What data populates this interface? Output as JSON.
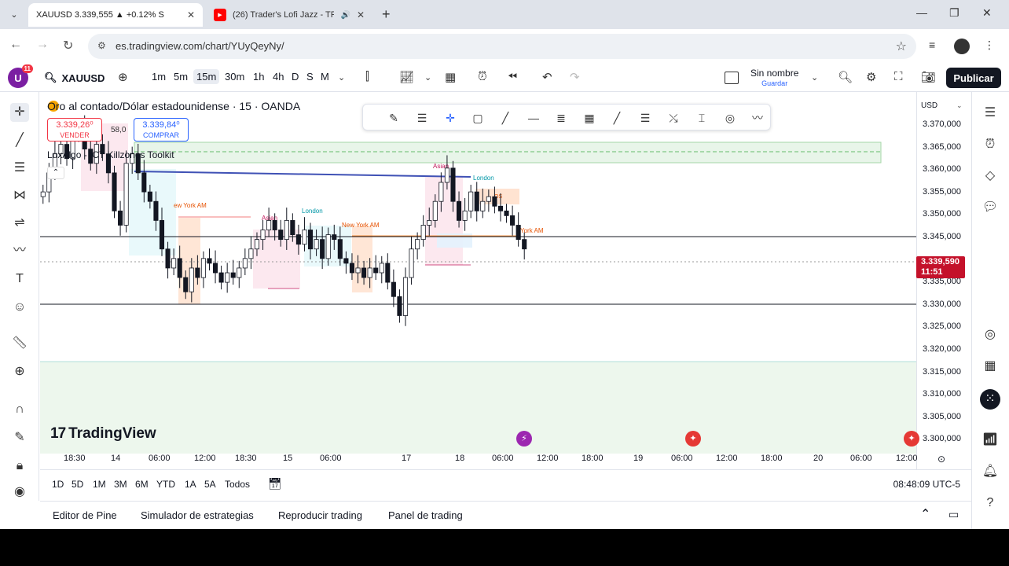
{
  "browser": {
    "tabs": [
      {
        "title": "XAUUSD 3.339,555 ▲ +0.12% S",
        "active": true,
        "favicon": "tradingview-icon"
      },
      {
        "title": "(26) Trader's Lofi Jazz - TRA",
        "active": false,
        "favicon": "youtube-icon"
      }
    ],
    "new_tab": "+",
    "url": "es.tradingview.com/chart/YUyQeyNy/"
  },
  "header": {
    "avatar_letter": "U",
    "notifications": "11",
    "symbol": "XAUUSD",
    "timeframes": [
      "1m",
      "5m",
      "15m",
      "30m",
      "1h",
      "4h",
      "D",
      "S",
      "M"
    ],
    "active_timeframe": "15m",
    "layout_name": "Sin nombre",
    "layout_status": "Guardar",
    "publish_label": "Publicar"
  },
  "legend": {
    "title": "Oro al contado/Dólar estadounidense · 15 · OANDA",
    "sell_price": "3.339,26⁰",
    "sell_label": "VENDER",
    "spread": "58,0",
    "buy_price": "3.339,84⁰",
    "buy_label": "COMPRAR",
    "indicator": "LuxAlgo - ICT Killzones Toolkit",
    "collapse": "⌃"
  },
  "price_axis": {
    "currency": "USD",
    "labels": [
      "3.370,000",
      "3.365,000",
      "3.360,000",
      "3.355,000",
      "3.350,000",
      "3.345,000",
      "3.335,000",
      "3.330,000",
      "3.325,000",
      "3.320,000",
      "3.315,000",
      "3.310,000",
      "3.305,000",
      "3.300,000"
    ],
    "current_price": "3.339,590",
    "countdown": "11:51"
  },
  "time_axis": {
    "labels": [
      "18:30",
      "14",
      "06:00",
      "12:00",
      "18:30",
      "15",
      "06:00",
      "17",
      "18",
      "06:00",
      "12:00",
      "18:00",
      "19",
      "06:00",
      "12:00",
      "18:00",
      "20",
      "06:00",
      "12:00"
    ]
  },
  "session_labels": {
    "asian1": "Asian",
    "london1": "London",
    "nyam1": "New York AM",
    "ny0": "ew York AM",
    "asian2": "Asian",
    "london2": "London",
    "nyam2": "York AM",
    "os": "OS"
  },
  "range_bar": {
    "ranges": [
      "1D",
      "5D",
      "1M",
      "3M",
      "6M",
      "YTD",
      "1A",
      "5A",
      "Todos"
    ],
    "clock": "08:48:09 UTC-5"
  },
  "bottom_panel": {
    "tabs": [
      "Editor de Pine",
      "Simulador de estrategias",
      "Reproducir trading",
      "Panel de trading"
    ]
  },
  "watermark": "TradingView",
  "colors": {
    "bull": "#26a69a",
    "bear": "#ef5350",
    "candle": "#131722",
    "price_tag": "#c4112a",
    "accent": "#2962ff"
  },
  "chart_data": {
    "type": "candlestick",
    "symbol": "XAUUSD",
    "timeframe": "15m",
    "ylim": [
      3297,
      3373
    ],
    "horizontal_lines": [
      3345.0,
      3330.0
    ],
    "current_price": 3339.59,
    "close_series": [
      3352,
      3356,
      3360,
      3362,
      3359,
      3364,
      3366,
      3361,
      3358,
      3362,
      3360,
      3356,
      3348,
      3345,
      3358,
      3360,
      3356,
      3352,
      3350,
      3346,
      3340,
      3336,
      3338,
      3334,
      3331,
      3336,
      3334,
      3338,
      3337,
      3335,
      3333,
      3335,
      3334,
      3336,
      3338,
      3340,
      3342,
      3344,
      3346,
      3344,
      3342,
      3346,
      3343,
      3341,
      3344,
      3340,
      3342,
      3338,
      3343,
      3342,
      3338,
      3337,
      3335,
      3336,
      3334,
      3336,
      3335,
      3337,
      3333,
      3330,
      3326,
      3334,
      3340,
      3342,
      3345,
      3346,
      3350,
      3354,
      3357,
      3350,
      3346,
      3348,
      3352,
      3348,
      3350,
      3351,
      3349,
      3348,
      3347,
      3345,
      3342,
      3340
    ]
  }
}
